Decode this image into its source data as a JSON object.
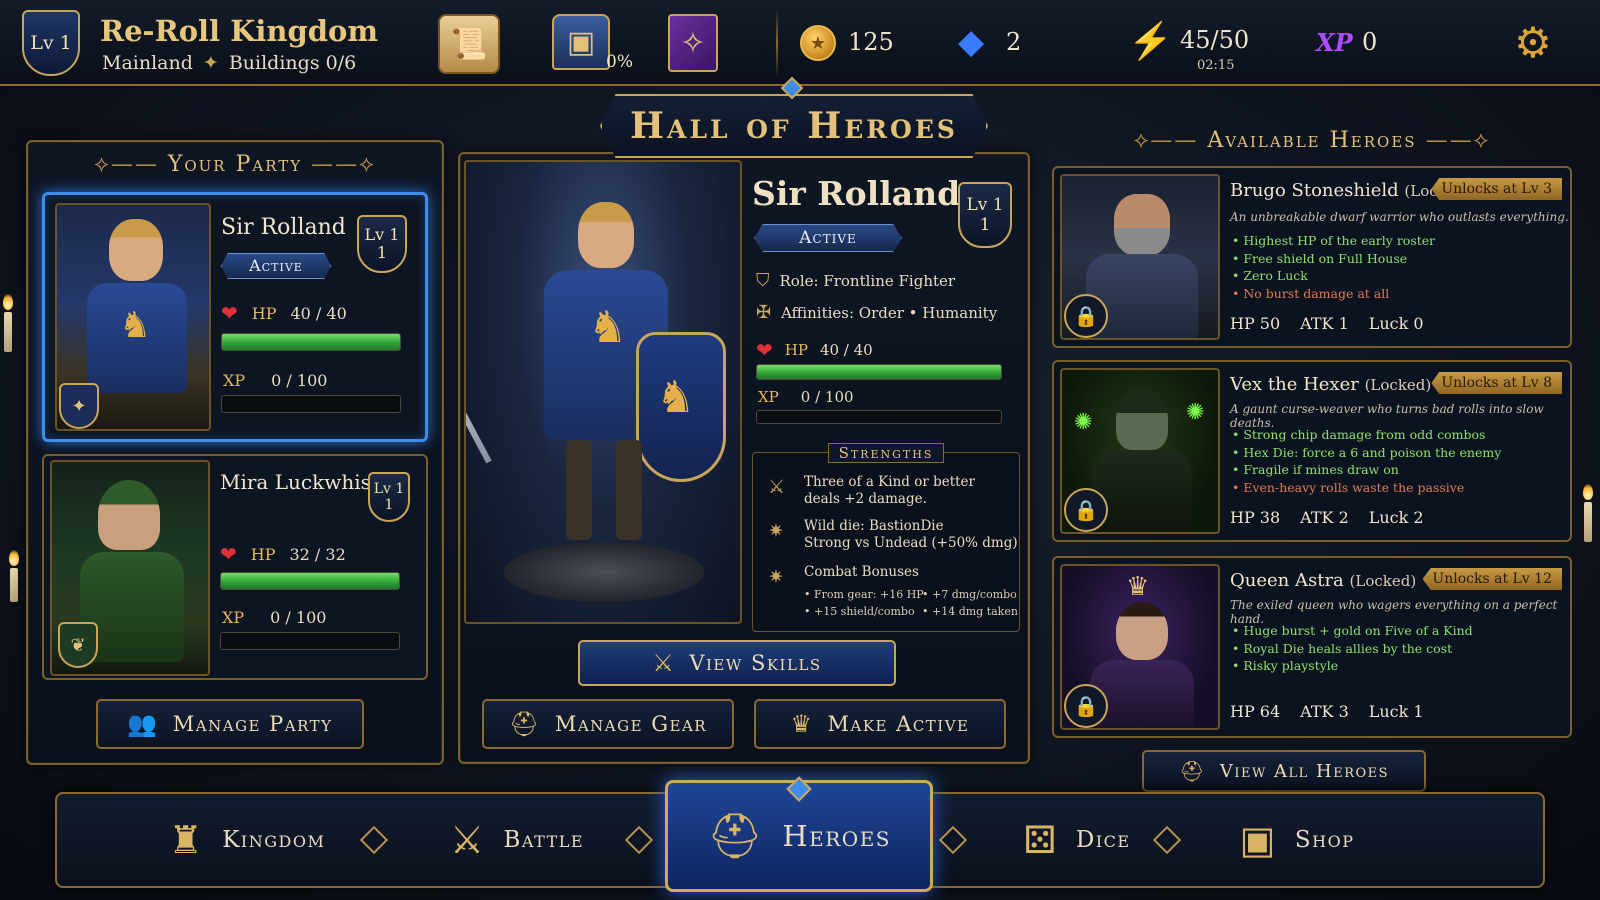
{
  "header": {
    "level": "Lv 1",
    "kingdom_name": "Re-Roll Kingdom",
    "location": "Mainland",
    "buildings": "Buildings 0/6",
    "chest_percent": "0%",
    "coins": "125",
    "gems": "2",
    "energy": "45/50",
    "energy_timer": "02:15",
    "xp_label": "XP",
    "xp_value": "0"
  },
  "party": {
    "title": "Your Party",
    "members": [
      {
        "name": "Sir Rolland",
        "active_label": "Active",
        "lv_label": "Lv 1",
        "lv_num": "1",
        "hp_label": "HP",
        "hp": "40 / 40",
        "hp_fraction": 1.0,
        "xp_label": "XP",
        "xp": "0 / 100",
        "xp_fraction": 0.0
      },
      {
        "name": "Mira Luckwhisper",
        "lv_label": "Lv 1",
        "lv_num": "1",
        "hp_label": "HP",
        "hp": "32 / 32",
        "hp_fraction": 1.0,
        "xp_label": "XP",
        "xp": "0 / 100",
        "xp_fraction": 0.0
      }
    ],
    "manage_button": "Manage Party"
  },
  "hall": {
    "title": "Hall of Heroes",
    "hero_name": "Sir Rolland",
    "active_label": "Active",
    "lv_label": "Lv 1",
    "lv_num": "1",
    "role": "Role: Frontline Fighter",
    "affinities": "Affinities: Order • Humanity",
    "hp_label": "HP",
    "hp": "40 / 40",
    "hp_fraction": 1.0,
    "xp_label": "XP",
    "xp": "0 / 100",
    "xp_fraction": 0.0,
    "strengths_title": "Strengths",
    "strength1_line1": "Three of a Kind or better",
    "strength1_line2": "deals +2 damage.",
    "strength2_line1": "Wild die: BastionDie",
    "strength2_line2": "Strong vs Undead (+50% dmg)",
    "strength3_title": "Combat Bonuses",
    "bonus1": "• From gear: +16 HP",
    "bonus2": "• +7 dmg/combo",
    "bonus3": "• +15 shield/combo",
    "bonus4": "• +14 dmg taken",
    "view_skills": "View Skills",
    "manage_gear": "Manage Gear",
    "make_active": "Make Active"
  },
  "available": {
    "title": "Available Heroes",
    "heroes": [
      {
        "name": "Brugo Stoneshield",
        "status": "(Locked)",
        "unlock": "Unlocks at Lv 3",
        "desc": "An unbreakable dwarf warrior who outlasts everything.",
        "traits": [
          "• Highest HP of the early roster",
          "• Free shield on Full House",
          "• Zero Luck",
          "• No burst damage at all"
        ],
        "hp": "HP 50",
        "atk": "ATK 1",
        "luck": "Luck 0"
      },
      {
        "name": "Vex the Hexer",
        "status": "(Locked)",
        "unlock": "Unlocks at Lv 8",
        "desc": "A gaunt curse-weaver who turns bad rolls into slow deaths.",
        "traits": [
          "• Strong chip damage from odd combos",
          "• Hex Die: force a 6 and poison the enemy",
          "• Fragile if mines draw on",
          "• Even-heavy rolls waste the passive"
        ],
        "hp": "HP 38",
        "atk": "ATK 2",
        "luck": "Luck 2"
      },
      {
        "name": "Queen Astra",
        "status": "(Locked)",
        "unlock": "Unlocks at Lv 12",
        "desc": "The exiled queen who wagers everything on a perfect hand.",
        "traits": [
          "• Huge burst + gold on Five of a Kind",
          "• Royal Die heals allies by the cost",
          "• Risky playstyle"
        ],
        "hp": "HP 64",
        "atk": "ATK 3",
        "luck": "Luck 1"
      }
    ],
    "view_all": "View All Heroes"
  },
  "nav": {
    "kingdom": "Kingdom",
    "battle": "Battle",
    "heroes": "Heroes",
    "dice": "Dice",
    "shop": "Shop"
  },
  "icons": {
    "scroll": "scroll-icon",
    "chest": "chest-icon",
    "spellbook": "spellbook-icon",
    "coin": "coin-icon",
    "gem": "gem-icon",
    "energy": "lightning-icon",
    "settings": "gear-icon"
  },
  "colors": {
    "gold": "#e3c17a",
    "hp_green": "#2f9e34",
    "active_blue": "#3f8de8",
    "xp_purple": "#b04cff",
    "gem_blue": "#3b7cff"
  }
}
